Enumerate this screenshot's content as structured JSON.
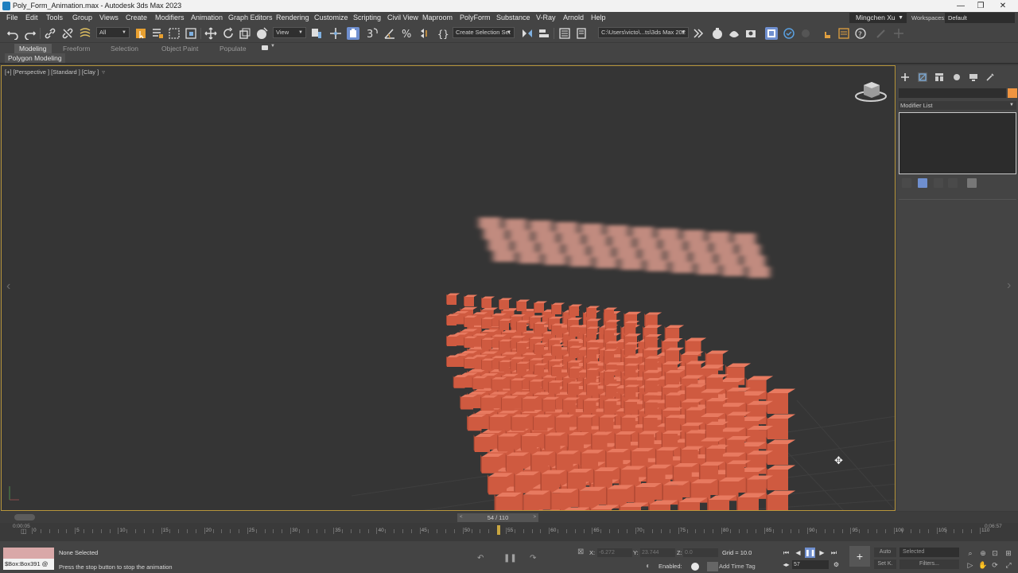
{
  "window": {
    "title": "Poly_Form_Animation.max - Autodesk 3ds Max 2023",
    "minimize": "—",
    "maximize": "❐",
    "close": "✕"
  },
  "menu": {
    "items": [
      "File",
      "Edit",
      "Tools",
      "Group",
      "Views",
      "Create",
      "Modifiers",
      "Animation",
      "Graph Editors",
      "Rendering",
      "Customize",
      "Scripting",
      "Civil View",
      "Maproom",
      "PolyForm",
      "Substance",
      "V-Ray",
      "Arnold",
      "Help"
    ],
    "user": "Mingchen Xu",
    "workspaces_label": "Workspaces:",
    "workspace": "Default"
  },
  "toolbar": {
    "filter_value": "All",
    "view_value": "View",
    "selection_set": "Create Selection Set",
    "project_path": "C:\\Users\\victo\\...ts\\3ds Max 202"
  },
  "ribbon": {
    "tabs": [
      "Modeling",
      "Freeform",
      "Selection",
      "Object Paint",
      "Populate"
    ],
    "active_tab": "Modeling",
    "sub_label": "Polygon Modeling"
  },
  "viewport": {
    "label": "[+] [Perspective ] [Standard ] [Clay ]",
    "filter_icon": "funnel-icon",
    "left_arrow": "‹",
    "cursor": "✥"
  },
  "command_panel": {
    "modifier_list": "Modifier List",
    "object_color": "#ef9440",
    "right_arrow": "›"
  },
  "time_slider": {
    "frame_label": "54 / 110",
    "current_frame": 54,
    "total_frames": 110,
    "prev": "<",
    "next": ">"
  },
  "track_bar": {
    "start_time": "0:00:05",
    "end_time": "0:06:57",
    "labels": [
      "0",
      "5",
      "10",
      "15",
      "20",
      "25",
      "30",
      "35",
      "40",
      "45",
      "50",
      "55",
      "60",
      "65",
      "70",
      "75",
      "80",
      "85",
      "90",
      "95",
      "100",
      "105",
      "110"
    ]
  },
  "status": {
    "script_text": "$Box:Box391 @",
    "selection": "None Selected",
    "prompt": "Press the stop button to stop the animation",
    "x_label": "X:",
    "y_label": "Y:",
    "z_label": "Z:",
    "x_value": "-6.272",
    "y_value": "23.744",
    "z_value": "0.0",
    "grid": "Grid = 10.0",
    "enabled": "Enabled:",
    "add_time_tag": "Add Time Tag",
    "frame_value": "57",
    "auto": "Auto",
    "set_key": "Set K.",
    "selected": "Selected",
    "filters": "Filters..."
  },
  "colors": {
    "cube": "#cf5a40",
    "cube_top": "#e87a60",
    "cube_side": "#b24a34",
    "viewport_bg": "#353535",
    "active_border": "#b8963c"
  }
}
